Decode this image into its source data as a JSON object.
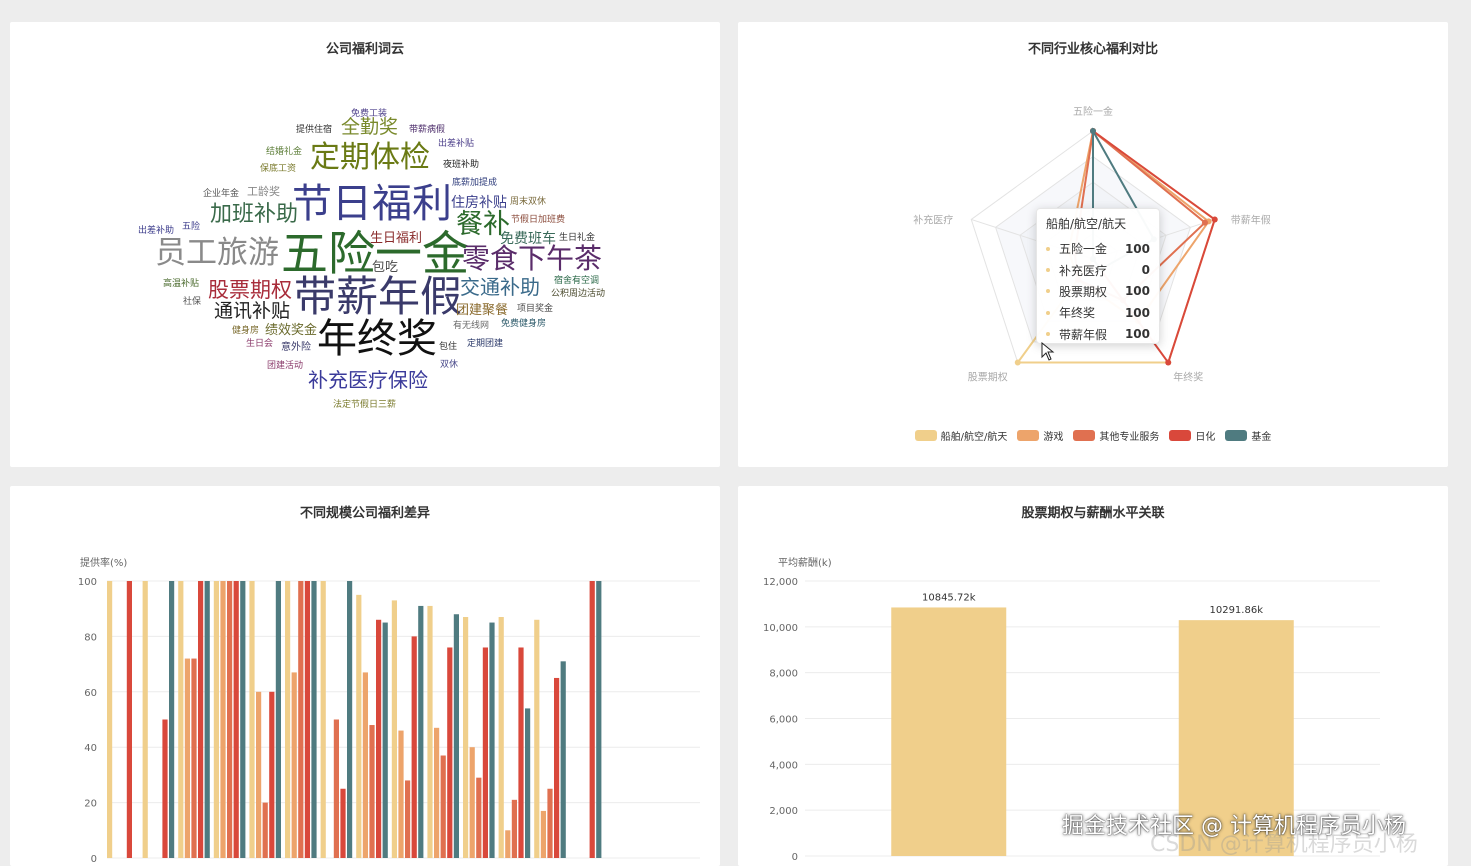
{
  "wordcloud_panel": {
    "title": "公司福利词云",
    "words": [
      {
        "text": "免费工装",
        "color": "#4c3f8a"
      },
      {
        "text": "提供住宿",
        "color": "#333333"
      },
      {
        "text": "全勤奖",
        "color": "#7a8a2c"
      },
      {
        "text": "带薪病假",
        "color": "#4c2c6a"
      },
      {
        "text": "结婚礼金",
        "color": "#5e7f3a"
      },
      {
        "text": "定期体检",
        "color": "#6a7a14"
      },
      {
        "text": "出差补贴",
        "color": "#4c3f8a"
      },
      {
        "text": "保底工资",
        "color": "#7a7a2c"
      },
      {
        "text": "夜班补助",
        "color": "#222222"
      },
      {
        "text": "企业年金",
        "color": "#555555"
      },
      {
        "text": "工龄奖",
        "color": "#888888"
      },
      {
        "text": "底薪加提成",
        "color": "#2c3a7a"
      },
      {
        "text": "节日福利",
        "color": "#3b3f8c"
      },
      {
        "text": "住房补贴",
        "color": "#3b3f8c"
      },
      {
        "text": "周末双休",
        "color": "#7a6a3c"
      },
      {
        "text": "加班补助",
        "color": "#3a6a4a"
      },
      {
        "text": "五险",
        "color": "#3a3a8a"
      },
      {
        "text": "餐补",
        "color": "#2c6a2c"
      },
      {
        "text": "节假日加班费",
        "color": "#8a4a3a"
      },
      {
        "text": "出差补助",
        "color": "#3a3a8a"
      },
      {
        "text": "生日福利",
        "color": "#8a2c2c"
      },
      {
        "text": "免费班车",
        "color": "#3a6a5a"
      },
      {
        "text": "生日礼金",
        "color": "#333333"
      },
      {
        "text": "员工旅游",
        "color": "#8a8a8a"
      },
      {
        "text": "五险一金",
        "color": "#2c6a2c"
      },
      {
        "text": "包吃",
        "color": "#4a4a4a"
      },
      {
        "text": "零食下午茶",
        "color": "#5a2c6a"
      },
      {
        "text": "高温补贴",
        "color": "#4a6a2c"
      },
      {
        "text": "股票期权",
        "color": "#a82c3a"
      },
      {
        "text": "带薪年假",
        "color": "#3a3a6a"
      },
      {
        "text": "交通补助",
        "color": "#3a6a8a"
      },
      {
        "text": "宿舍有空调",
        "color": "#2c6a4a"
      },
      {
        "text": "社保",
        "color": "#555555"
      },
      {
        "text": "公积周边活动",
        "color": "#4a4a2c"
      },
      {
        "text": "通讯补贴",
        "color": "#222222"
      },
      {
        "text": "团建聚餐",
        "color": "#8a6a2c"
      },
      {
        "text": "项目奖金",
        "color": "#4a4a4a"
      },
      {
        "text": "健身房",
        "color": "#7a6a2c"
      },
      {
        "text": "绩效奖金",
        "color": "#6a6a2c"
      },
      {
        "text": "有无线网",
        "color": "#6a6a6a"
      },
      {
        "text": "免费健身房",
        "color": "#2c5a6a"
      },
      {
        "text": "生日会",
        "color": "#8a3a6a"
      },
      {
        "text": "意外险",
        "color": "#3a3a6a"
      },
      {
        "text": "年终奖",
        "color": "#111111"
      },
      {
        "text": "包住",
        "color": "#333333"
      },
      {
        "text": "定期团建",
        "color": "#2c3a6a"
      },
      {
        "text": "团建活动",
        "color": "#8a3a6a"
      },
      {
        "text": "双休",
        "color": "#4a4a8a"
      },
      {
        "text": "补充医疗保险",
        "color": "#3a3a9a"
      },
      {
        "text": "法定节假日三薪",
        "color": "#7a7a2c"
      }
    ]
  },
  "radar_panel": {
    "title": "不同行业核心福利对比",
    "tooltip": {
      "title": "船舶/航空/航天",
      "rows": [
        {
          "name": "五险一金",
          "value": "100"
        },
        {
          "name": "补充医疗",
          "value": "0"
        },
        {
          "name": "股票期权",
          "value": "100"
        },
        {
          "name": "年终奖",
          "value": "100"
        },
        {
          "name": "带薪年假",
          "value": "100"
        }
      ]
    }
  },
  "bars_panel": {
    "title": "不同规模公司福利差异"
  },
  "salary_panel": {
    "title": "股票期权与薪酬水平关联"
  },
  "watermark": {
    "text": "掘金技术社区 @ 计算机程序员小杨",
    "text2": "CSDN @计算机程序员小杨"
  },
  "chart_data": [
    {
      "type": "radar",
      "indicators": [
        "五险一金",
        "带薪年假",
        "年终奖",
        "股票期权",
        "补充医疗"
      ],
      "max": 100,
      "series": [
        {
          "name": "船舶/航空/航天",
          "color": "#f0cf8b",
          "values": [
            100,
            100,
            100,
            100,
            0
          ]
        },
        {
          "name": "游戏",
          "color": "#eda46b",
          "values": [
            100,
            95,
            60,
            20,
            20
          ]
        },
        {
          "name": "其他专业服务",
          "color": "#e07050",
          "values": [
            100,
            92,
            40,
            20,
            15
          ]
        },
        {
          "name": "日化",
          "color": "#d9483b",
          "values": [
            100,
            100,
            100,
            0,
            0
          ]
        },
        {
          "name": "基金",
          "color": "#4f7b80",
          "values": [
            100,
            50,
            10,
            0,
            0
          ]
        }
      ],
      "legend_position": "bottom"
    },
    {
      "type": "bar",
      "ylabel": "提供率(%)",
      "ylim": [
        0,
        100
      ],
      "yticks": [
        0,
        20,
        40,
        60,
        80,
        100
      ],
      "series_colors": [
        "#f0cf8b",
        "#eda46b",
        "#e07050",
        "#d9483b",
        "#4f7b80"
      ],
      "groups": [
        [
          100,
          0,
          0,
          100,
          0
        ],
        [
          100,
          0,
          0,
          50,
          100
        ],
        [
          100,
          72,
          72,
          100,
          100
        ],
        [
          100,
          100,
          100,
          100,
          100
        ],
        [
          100,
          60,
          20,
          60,
          100
        ],
        [
          100,
          67,
          100,
          100,
          100
        ],
        [
          100,
          0,
          50,
          25,
          100
        ],
        [
          95,
          67,
          48,
          86,
          85
        ],
        [
          93,
          46,
          28,
          80,
          91
        ],
        [
          91,
          47,
          37,
          76,
          88
        ],
        [
          87,
          40,
          29,
          76,
          85
        ],
        [
          87,
          10,
          21,
          76,
          54
        ],
        [
          86,
          17,
          25,
          65,
          71
        ],
        [
          0,
          0,
          0,
          100,
          100
        ]
      ],
      "grid": true
    },
    {
      "type": "bar",
      "ylabel": "平均薪酬(k)",
      "ylim": [
        0,
        12000
      ],
      "yticks": [
        "0",
        "2,000",
        "4,000",
        "6,000",
        "8,000",
        "10,000",
        "12,000"
      ],
      "values": [
        10845.72,
        10291.86
      ],
      "data_labels": [
        "10845.72k",
        "10291.86k"
      ],
      "color": "#f0cf8b",
      "grid": true
    }
  ]
}
